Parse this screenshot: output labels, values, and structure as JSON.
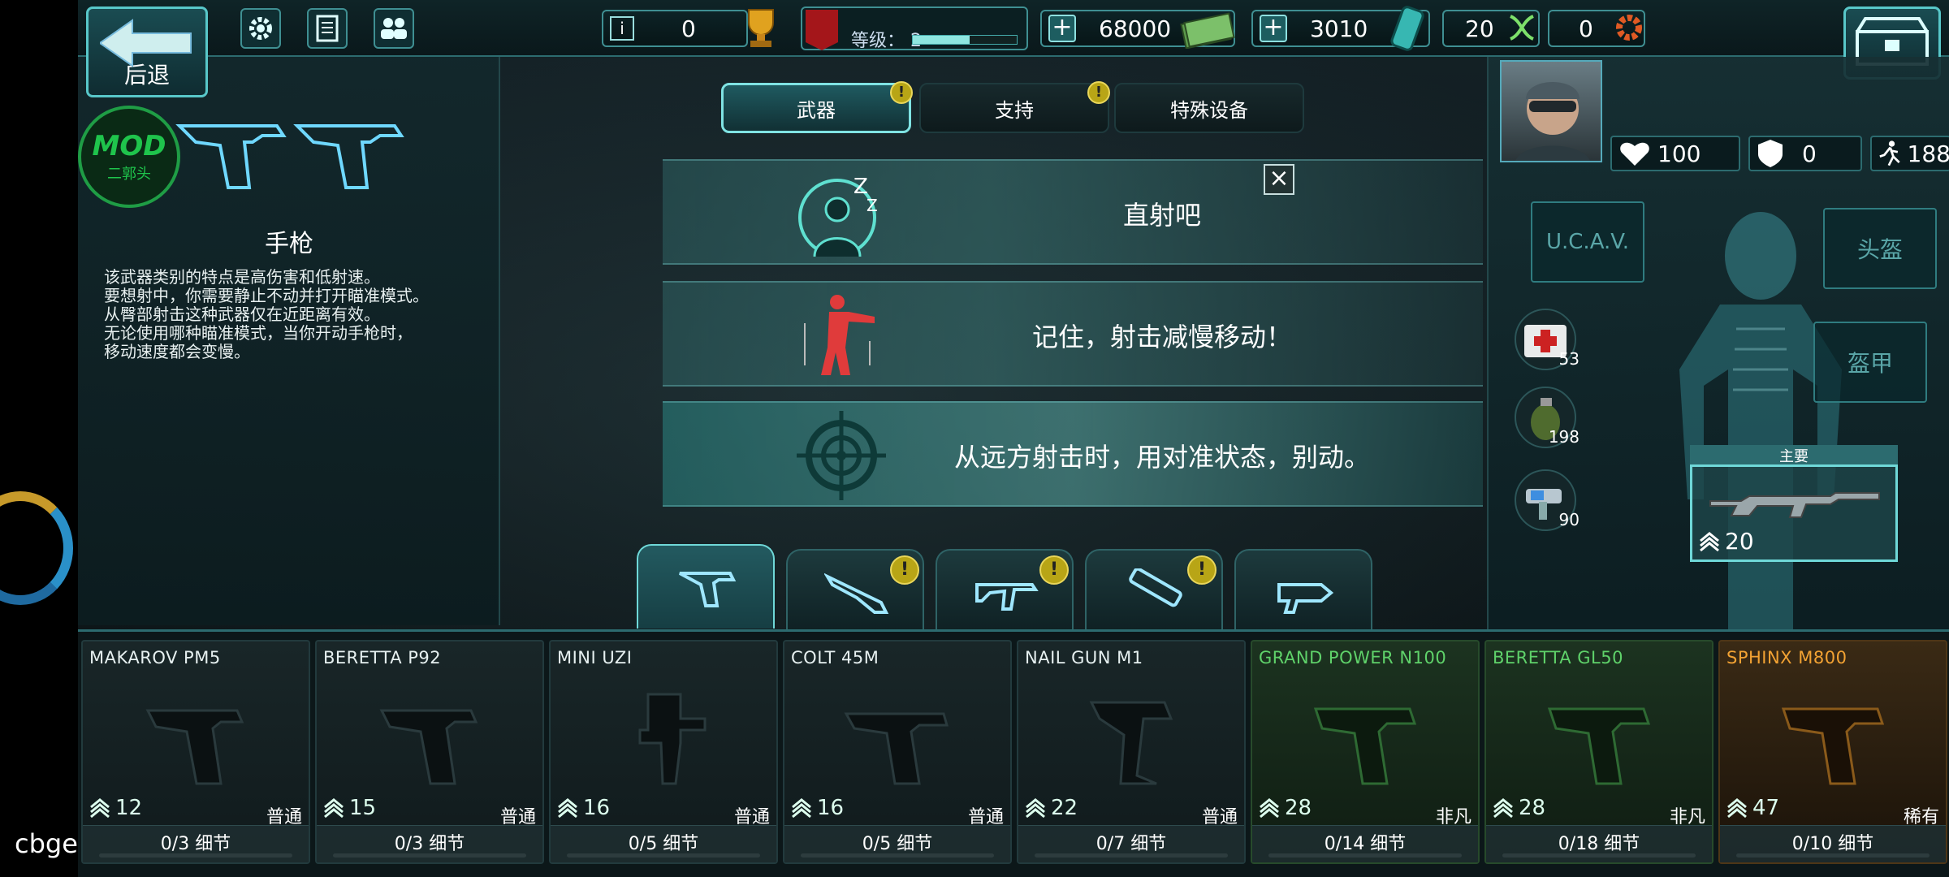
{
  "top": {
    "back_label": "后退",
    "trophy_value": "0",
    "rank_label": "等级：",
    "rank_level": "2",
    "rank_progress": 0.55,
    "cash": "68000",
    "gems": "3010",
    "dna": "20",
    "gears": "0"
  },
  "left": {
    "mod_title": "MOD",
    "mod_sub": "二郭头",
    "weapon_type": "手枪",
    "description": [
      "该武器类别的特点是高伤害和低射速。",
      "要想射中，你需要静止不动并打开瞄准模式。",
      "从臀部射击这种武器仅在近距离有效。",
      "无论使用哪种瞄准模式，当你开动手枪时，",
      "移动速度都会变慢。"
    ]
  },
  "tabs": [
    {
      "label": "武器",
      "badge": true
    },
    {
      "label": "支持",
      "badge": true
    },
    {
      "label": "特殊设备",
      "badge": false
    }
  ],
  "tips": [
    "直射吧",
    "记住，射击减慢移动！",
    "从远方射击时，用对准状态，别动。"
  ],
  "right": {
    "health": "100",
    "armor": "0",
    "speed": "188",
    "slot_uav": "U.C.A.V.",
    "slot_helmet": "头盔",
    "slot_armor": "盔甲",
    "medkit_count": "53",
    "grenade_count": "198",
    "gadget_count": "90",
    "primary_label": "主要",
    "primary_level": "20"
  },
  "weapons": [
    {
      "name": "MAKAROV PM5",
      "level": "12",
      "rarity": "普通",
      "progress": "0/3 细节",
      "tier": "normal"
    },
    {
      "name": "BERETTA P92",
      "level": "15",
      "rarity": "普通",
      "progress": "0/3 细节",
      "tier": "normal"
    },
    {
      "name": "MINI UZI",
      "level": "16",
      "rarity": "普通",
      "progress": "0/5 细节",
      "tier": "normal"
    },
    {
      "name": "COLT 45M",
      "level": "16",
      "rarity": "普通",
      "progress": "0/5 细节",
      "tier": "normal"
    },
    {
      "name": "NAIL GUN M1",
      "level": "22",
      "rarity": "普通",
      "progress": "0/7 细节",
      "tier": "normal"
    },
    {
      "name": "GRAND POWER N100",
      "level": "28",
      "rarity": "非凡",
      "progress": "0/14 细节",
      "tier": "green"
    },
    {
      "name": "BERETTA GL50",
      "level": "28",
      "rarity": "非凡",
      "progress": "0/18 细节",
      "tier": "green"
    },
    {
      "name": "SPHINX M800",
      "level": "47",
      "rarity": "稀有",
      "progress": "0/10 细节",
      "tier": "orange"
    }
  ],
  "overlay": {
    "watermark": "cbge.top"
  }
}
